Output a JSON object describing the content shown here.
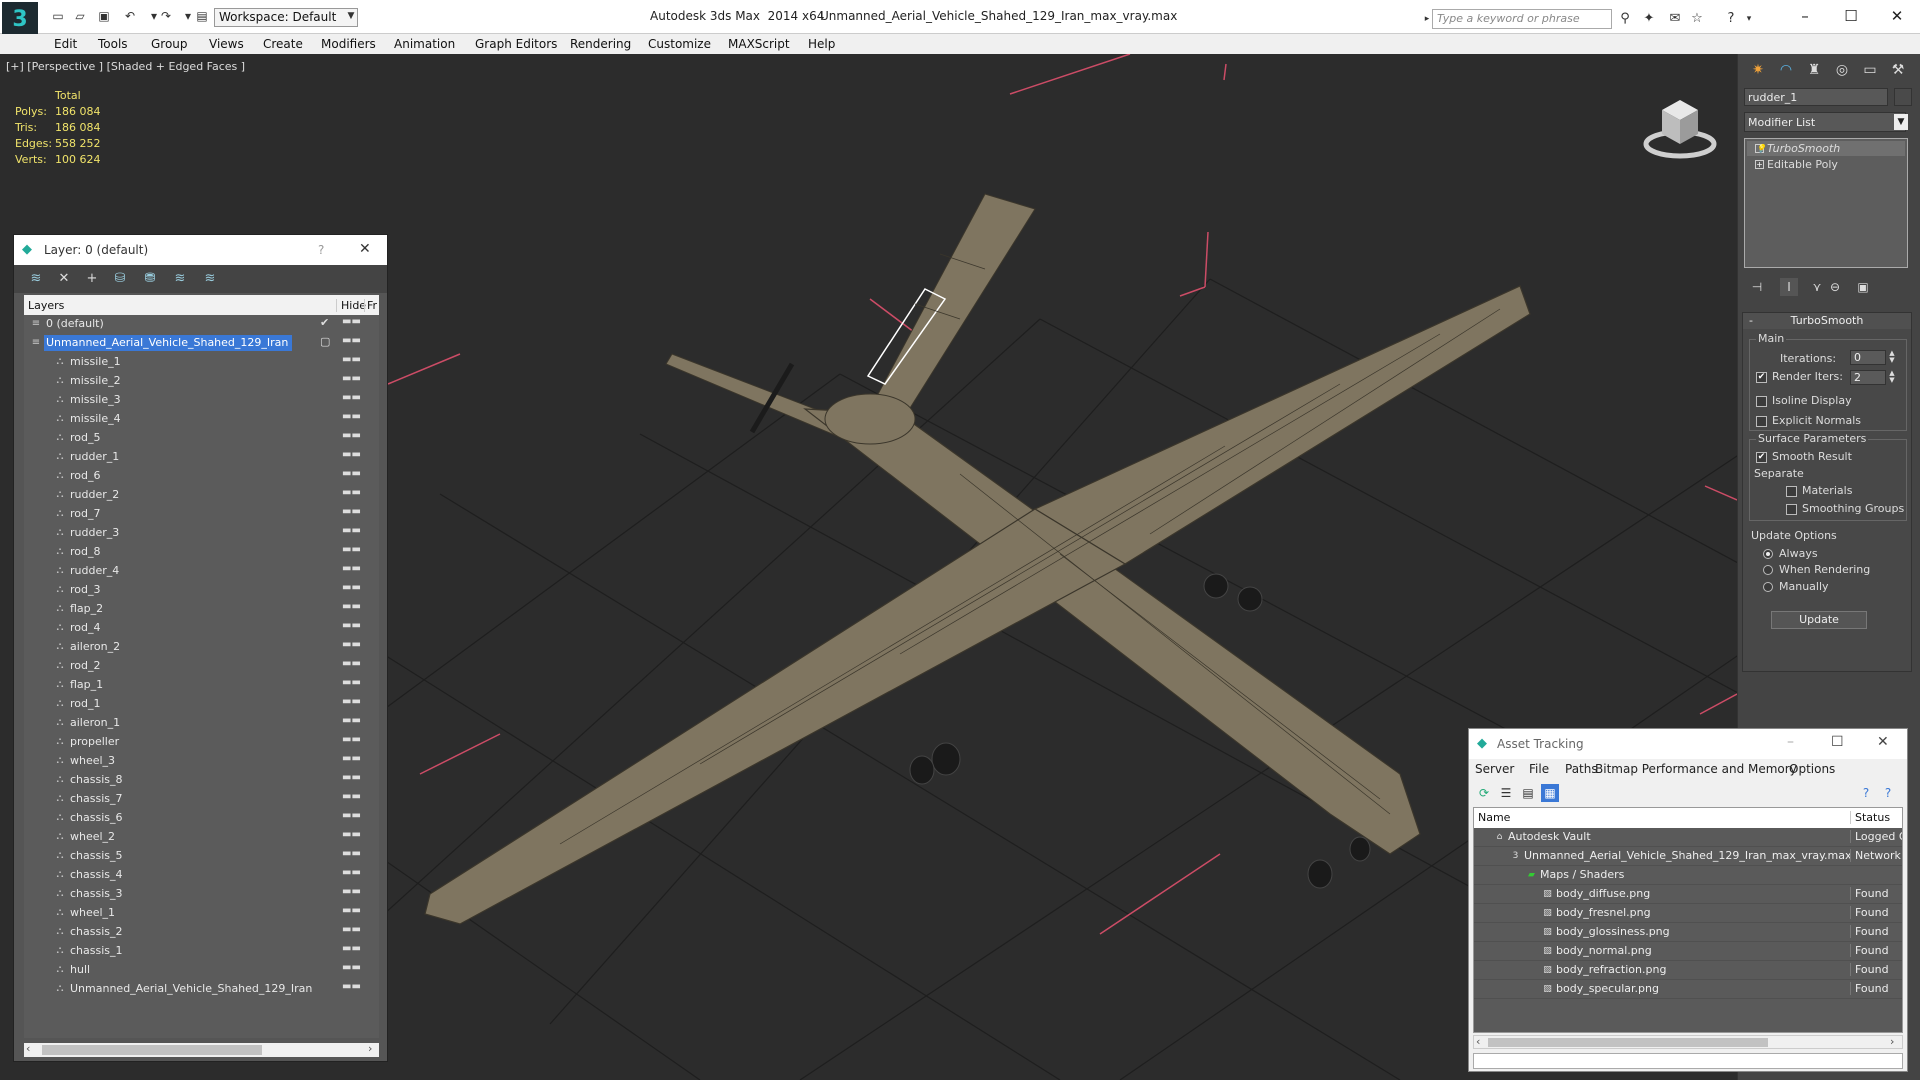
{
  "titlebar": {
    "app": "Autodesk 3ds Max  2014 x64",
    "file": "Unmanned_Aerial_Vehicle_Shahed_129_Iran_max_vray.max",
    "workspace": "Workspace: Default",
    "search_placeholder": "Type a keyword or phrase",
    "window_buttons": [
      "–",
      "☐",
      "✕"
    ]
  },
  "menu": [
    "Edit",
    "Tools",
    "Group",
    "Views",
    "Create",
    "Modifiers",
    "Animation",
    "Graph Editors",
    "Rendering",
    "Customize",
    "MAXScript",
    "Help"
  ],
  "viewport": {
    "label": "[+] [Perspective ] [Shaded + Edged Faces ]",
    "stats_header": "Total",
    "stats": [
      {
        "key": "Polys:",
        "value": "186 084"
      },
      {
        "key": "Tris:",
        "value": "186 084"
      },
      {
        "key": "Edges:",
        "value": "558 252"
      },
      {
        "key": "Verts:",
        "value": "100 624"
      }
    ],
    "colors": {
      "background": "#2c2c2c",
      "grid": "#1f1f1f",
      "mesh": "#7f7560",
      "wire": "#3b362b",
      "accent_lines": "#d0506a"
    }
  },
  "layer_dialog": {
    "title": "Layer: 0 (default)",
    "help": "?",
    "close": "✕",
    "columns": [
      "Layers",
      "Hide",
      "Fr"
    ],
    "rows": [
      {
        "label": "0 (default)",
        "level": 0,
        "check": "✔"
      },
      {
        "label": "Unmanned_Aerial_Vehicle_Shahed_129_Iran",
        "level": 0,
        "selected": true,
        "check": "▢"
      },
      {
        "label": "missile_1",
        "level": 1
      },
      {
        "label": "missile_2",
        "level": 1
      },
      {
        "label": "missile_3",
        "level": 1
      },
      {
        "label": "missile_4",
        "level": 1
      },
      {
        "label": "rod_5",
        "level": 1
      },
      {
        "label": "rudder_1",
        "level": 1
      },
      {
        "label": "rod_6",
        "level": 1
      },
      {
        "label": "rudder_2",
        "level": 1
      },
      {
        "label": "rod_7",
        "level": 1
      },
      {
        "label": "rudder_3",
        "level": 1
      },
      {
        "label": "rod_8",
        "level": 1
      },
      {
        "label": "rudder_4",
        "level": 1
      },
      {
        "label": "rod_3",
        "level": 1
      },
      {
        "label": "flap_2",
        "level": 1
      },
      {
        "label": "rod_4",
        "level": 1
      },
      {
        "label": "aileron_2",
        "level": 1
      },
      {
        "label": "rod_2",
        "level": 1
      },
      {
        "label": "flap_1",
        "level": 1
      },
      {
        "label": "rod_1",
        "level": 1
      },
      {
        "label": "aileron_1",
        "level": 1
      },
      {
        "label": "propeller",
        "level": 1
      },
      {
        "label": "wheel_3",
        "level": 1
      },
      {
        "label": "chassis_8",
        "level": 1
      },
      {
        "label": "chassis_7",
        "level": 1
      },
      {
        "label": "chassis_6",
        "level": 1
      },
      {
        "label": "wheel_2",
        "level": 1
      },
      {
        "label": "chassis_5",
        "level": 1
      },
      {
        "label": "chassis_4",
        "level": 1
      },
      {
        "label": "chassis_3",
        "level": 1
      },
      {
        "label": "wheel_1",
        "level": 1
      },
      {
        "label": "chassis_2",
        "level": 1
      },
      {
        "label": "chassis_1",
        "level": 1
      },
      {
        "label": "hull",
        "level": 1
      },
      {
        "label": "Unmanned_Aerial_Vehicle_Shahed_129_Iran",
        "level": 1
      }
    ],
    "hide_marker": "▬▬",
    "scroll_left": "‹",
    "scroll_right": "›"
  },
  "command_panel": {
    "object_name": "rudder_1",
    "modifier_list": "Modifier List",
    "stack": [
      {
        "label": "TurboSmooth",
        "selected": true,
        "icon": "💡"
      },
      {
        "label": "Editable Poly",
        "selected": false,
        "icon": "+"
      }
    ],
    "turbosmooth": {
      "title": "TurboSmooth",
      "collapse": "-",
      "main_label": "Main",
      "iterations_label": "Iterations:",
      "iterations_value": "0",
      "render_iters_label": "Render Iters:",
      "render_iters_value": "2",
      "render_iters_checked": true,
      "isoline_label": "Isoline Display",
      "isoline_checked": false,
      "explicit_normals_label": "Explicit Normals",
      "explicit_normals_checked": false,
      "surface_label": "Surface Parameters",
      "smooth_result_label": "Smooth Result",
      "smooth_result_checked": true,
      "separate_label": "Separate",
      "materials_label": "Materials",
      "materials_checked": false,
      "smoothing_groups_label": "Smoothing Groups",
      "smoothing_groups_checked": false,
      "update_options_label": "Update Options",
      "always_label": "Always",
      "when_rendering_label": "When Rendering",
      "manually_label": "Manually",
      "selected_update_option": "Always",
      "update_button": "Update"
    }
  },
  "asset_tracking": {
    "title": "Asset Tracking",
    "window_buttons": [
      "–",
      "☐",
      "✕"
    ],
    "menu": [
      "Server",
      "File",
      "Paths",
      "Bitmap Performance and Memory",
      "Options"
    ],
    "columns": [
      "Name",
      "Status"
    ],
    "rows": [
      {
        "name": "Autodesk Vault",
        "status": "Logged O",
        "indent": 0,
        "icon": "vault-icon"
      },
      {
        "name": "Unmanned_Aerial_Vehicle_Shahed_129_Iran_max_vray.max",
        "status": "Network",
        "indent": 1,
        "icon": "max-file-icon"
      },
      {
        "name": "Maps / Shaders",
        "status": "",
        "indent": 2,
        "icon": "maps-folder-icon"
      },
      {
        "name": "body_diffuse.png",
        "status": "Found",
        "indent": 3,
        "icon": "image-file-icon"
      },
      {
        "name": "body_fresnel.png",
        "status": "Found",
        "indent": 3,
        "icon": "image-file-icon"
      },
      {
        "name": "body_glossiness.png",
        "status": "Found",
        "indent": 3,
        "icon": "image-file-icon"
      },
      {
        "name": "body_normal.png",
        "status": "Found",
        "indent": 3,
        "icon": "image-file-icon"
      },
      {
        "name": "body_refraction.png",
        "status": "Found",
        "indent": 3,
        "icon": "image-file-icon"
      },
      {
        "name": "body_specular.png",
        "status": "Found",
        "indent": 3,
        "icon": "image-file-icon"
      }
    ],
    "scroll_left": "‹",
    "scroll_right": "›"
  }
}
